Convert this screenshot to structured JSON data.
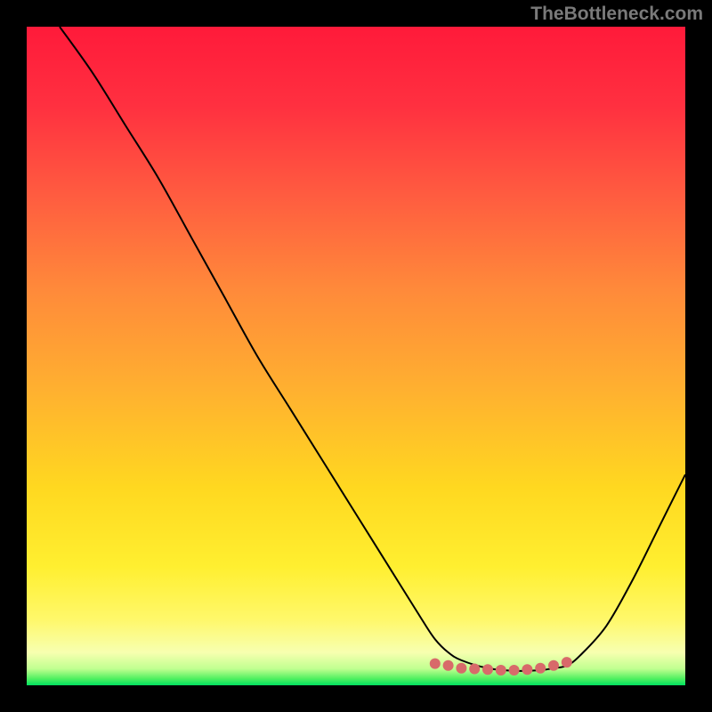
{
  "watermark": "TheBottleneck.com",
  "chart_data": {
    "type": "line",
    "title": "",
    "xlabel": "",
    "ylabel": "",
    "xlim": [
      0,
      100
    ],
    "ylim": [
      0,
      100
    ],
    "gradient_stops": [
      {
        "offset": 0.0,
        "color": "#ff1a3a"
      },
      {
        "offset": 0.12,
        "color": "#ff3040"
      },
      {
        "offset": 0.25,
        "color": "#ff5a40"
      },
      {
        "offset": 0.4,
        "color": "#ff8a3a"
      },
      {
        "offset": 0.55,
        "color": "#ffb030"
      },
      {
        "offset": 0.7,
        "color": "#ffd820"
      },
      {
        "offset": 0.82,
        "color": "#ffef30"
      },
      {
        "offset": 0.9,
        "color": "#fff86a"
      },
      {
        "offset": 0.95,
        "color": "#f7ffb0"
      },
      {
        "offset": 0.975,
        "color": "#c0ff90"
      },
      {
        "offset": 0.99,
        "color": "#50f060"
      },
      {
        "offset": 1.0,
        "color": "#00e060"
      }
    ],
    "series": [
      {
        "name": "curve",
        "color": "#000000",
        "width": 2,
        "x": [
          5,
          10,
          15,
          20,
          25,
          30,
          35,
          40,
          45,
          50,
          55,
          60,
          62,
          64,
          66,
          70,
          74,
          78,
          80,
          82,
          84,
          88,
          92,
          96,
          100
        ],
        "y": [
          100,
          93,
          85,
          77,
          68,
          59,
          50,
          42,
          34,
          26,
          18,
          10,
          7,
          5,
          3.8,
          2.6,
          2.2,
          2.3,
          2.6,
          3.0,
          4.5,
          9,
          16,
          24,
          32
        ]
      }
    ],
    "markers": {
      "name": "bottom-dots",
      "color": "#d86a6a",
      "radius": 6,
      "x": [
        62,
        64,
        66,
        68,
        70,
        72,
        74,
        76,
        78,
        80,
        82
      ],
      "y": [
        3.3,
        3.0,
        2.6,
        2.5,
        2.4,
        2.3,
        2.3,
        2.4,
        2.6,
        3.0,
        3.5
      ]
    }
  }
}
